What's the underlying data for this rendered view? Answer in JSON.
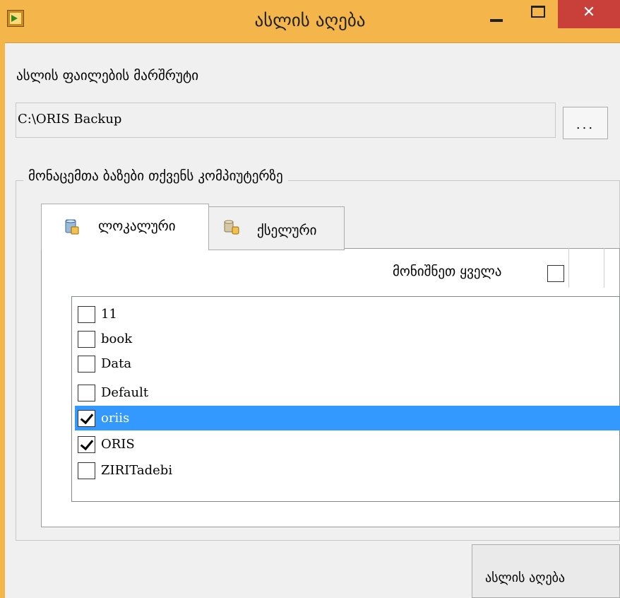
{
  "window": {
    "title": "ასლის აღება",
    "minimize_label": "–",
    "maximize_label": "□",
    "close_label": "✕"
  },
  "route": {
    "label": "ასლის ფაილების მარშრუტი",
    "path": "C:\\ORIS Backup",
    "browse_label": "..."
  },
  "group": {
    "legend": "მონაცემთა ბაზები თქვენს კომპიუტერზე"
  },
  "tabs": [
    {
      "label": "ლოკალური",
      "icon": "database-local-icon",
      "active": true
    },
    {
      "label": "ქსელური",
      "icon": "database-network-icon",
      "active": false
    }
  ],
  "select_all": {
    "label": "მონიშნეთ ყველა",
    "checked": false
  },
  "databases": [
    {
      "name": "11",
      "checked": false,
      "selected": false
    },
    {
      "name": "book",
      "checked": false,
      "selected": false
    },
    {
      "name": "Data",
      "checked": false,
      "selected": false
    },
    {
      "name": "Default",
      "checked": false,
      "selected": false
    },
    {
      "name": "oriis",
      "checked": true,
      "selected": true
    },
    {
      "name": "ORIS",
      "checked": true,
      "selected": false
    },
    {
      "name": "ZIRITadebi",
      "checked": false,
      "selected": false
    }
  ],
  "action_button": {
    "label": "ასლის აღება"
  },
  "colors": {
    "titlebar": "#f4b64a",
    "close": "#c9403a",
    "selection": "#3399ff"
  }
}
